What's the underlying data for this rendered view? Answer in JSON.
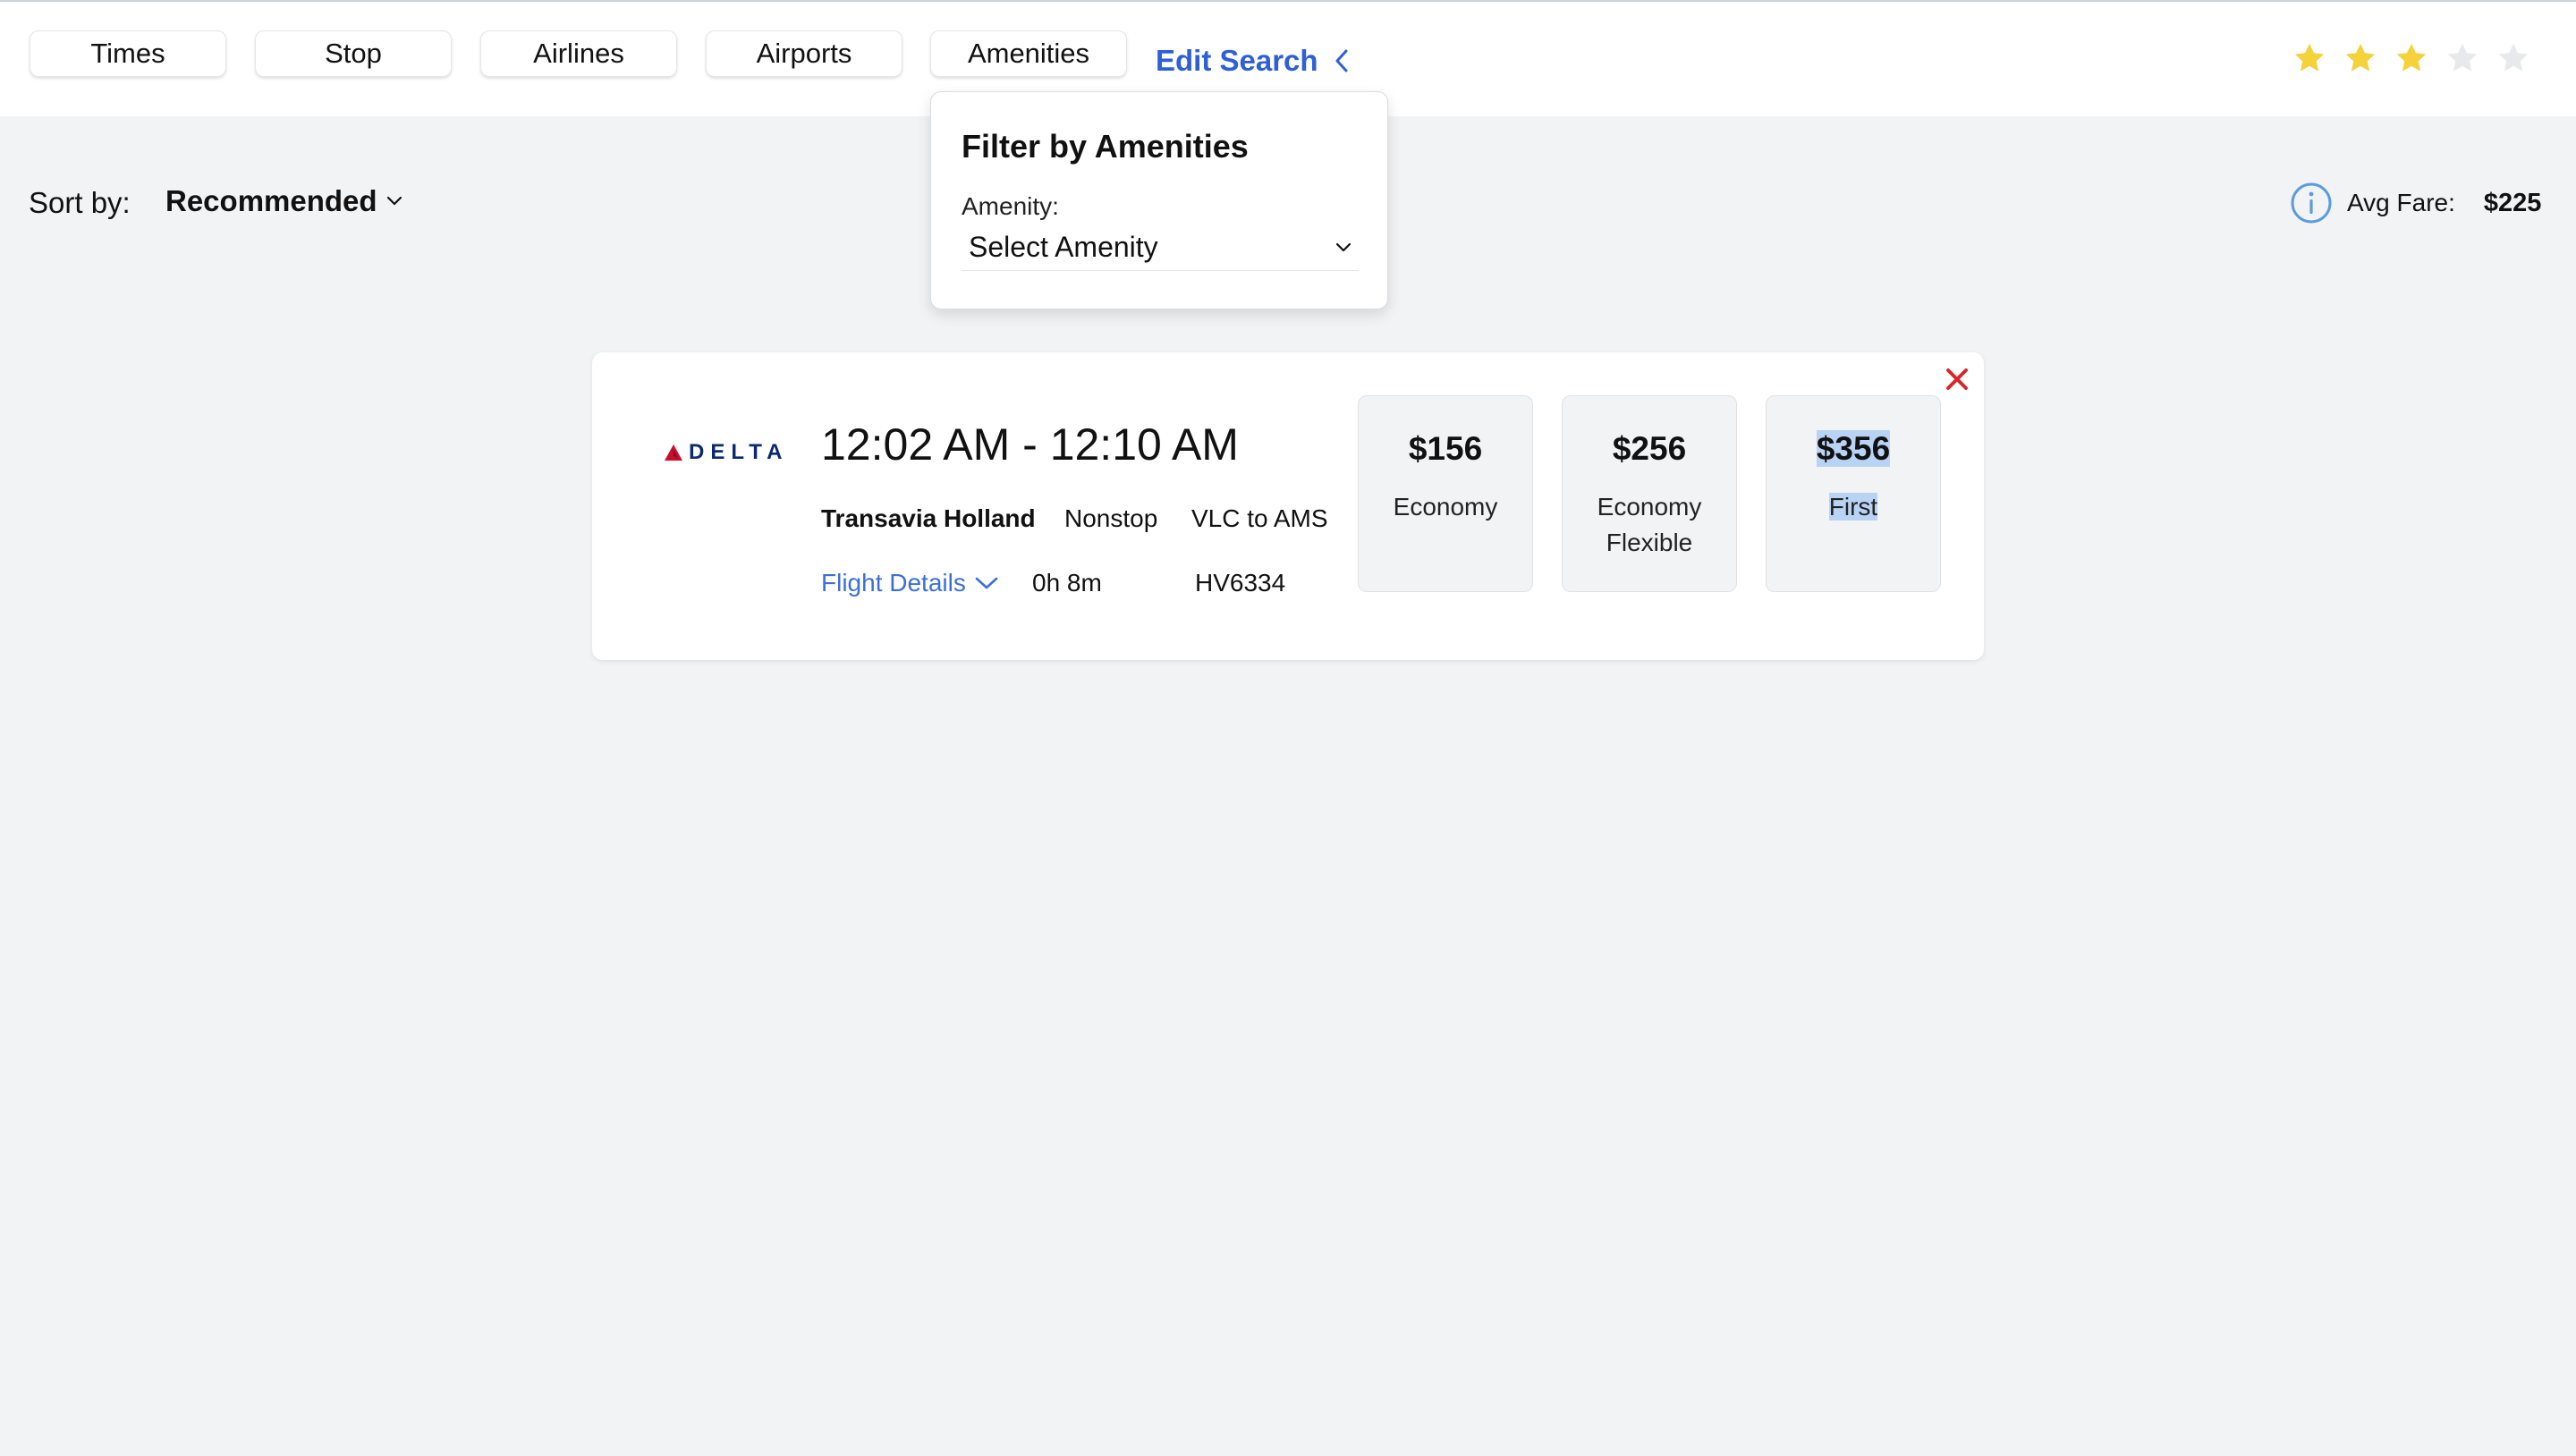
{
  "filters": {
    "buttons": [
      "Times",
      "Stop",
      "Airlines",
      "Airports",
      "Amenities"
    ],
    "edit_search": "Edit Search"
  },
  "rating": {
    "filled": 3,
    "total": 5,
    "filled_color": "#f5d13a",
    "empty_color": "#e8e9ec"
  },
  "amenities_dropdown": {
    "title": "Filter by Amenities",
    "label": "Amenity:",
    "selected": "Select Amenity"
  },
  "sort": {
    "label": "Sort by:",
    "value": "Recommended"
  },
  "avg_fare": {
    "label": "Avg Fare:",
    "value": "$225"
  },
  "flight": {
    "airline_logo": "DELTA",
    "times": "12:02 AM - 12:10 AM",
    "carrier": "Transavia Holland",
    "stops": "Nonstop",
    "route": "VLC to AMS",
    "details_link": "Flight Details",
    "duration": "0h 8m",
    "flight_number": "HV6334",
    "fares": [
      {
        "price": "$156",
        "class": "Economy"
      },
      {
        "price": "$256",
        "class": "Economy Flexible"
      },
      {
        "price": "$356",
        "class": "First"
      }
    ]
  },
  "colors": {
    "accent": "#2f5fd8",
    "link": "#3b6fd8",
    "close": "#d9262c",
    "delta_red": "#c8102e",
    "delta_navy": "#0b2a6e"
  }
}
